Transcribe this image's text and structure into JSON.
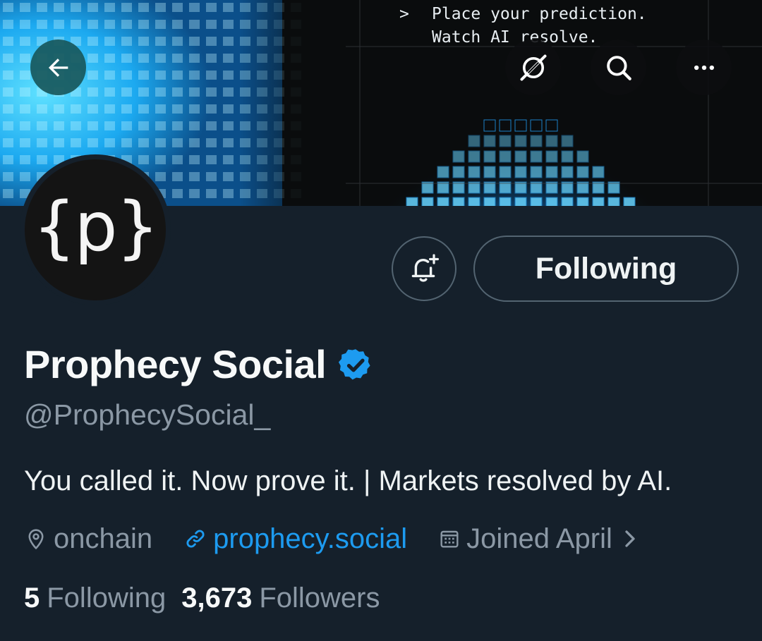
{
  "banner": {
    "prompt_symbol": ">",
    "line1": "Place your prediction.",
    "line2": "Watch AI resolve."
  },
  "header": {
    "back_icon": "arrow-left-icon",
    "grok_icon": "grok-icon",
    "search_icon": "search-icon",
    "more_icon": "more-horizontal-icon"
  },
  "avatar": {
    "text": "{p}"
  },
  "actions": {
    "notify_icon": "bell-plus-icon",
    "following_label": "Following"
  },
  "profile": {
    "name": "Prophecy Social",
    "verified": true,
    "handle": "@ProphecySocial_",
    "bio": "You called it. Now prove it. | Markets resolved by AI.",
    "location": "onchain",
    "website": "prophecy.social",
    "joined": "Joined April"
  },
  "stats": {
    "following_count": "5",
    "following_label": "Following",
    "followers_count": "3,673",
    "followers_label": "Followers"
  },
  "colors": {
    "background": "#15202b",
    "accent_blue": "#1d9bf0",
    "secondary_text": "#8b98a5",
    "primary_text": "#eff3f4",
    "banner_cyan": "#36c6ff"
  }
}
